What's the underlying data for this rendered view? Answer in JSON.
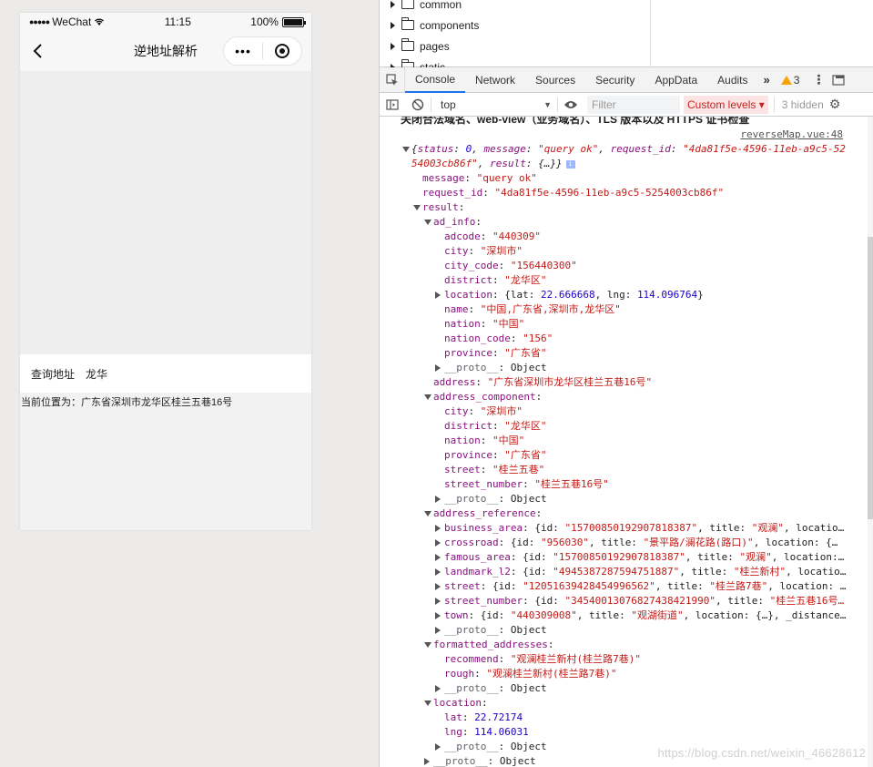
{
  "phone": {
    "status": {
      "carrier": "WeChat",
      "time": "11:15",
      "battery": "100%",
      "battery_level": 1.0
    },
    "nav": {
      "title": "逆地址解析",
      "more_label": "•••"
    },
    "query": {
      "label": "查询地址",
      "value": "龙华"
    },
    "current_location": "当前位置为：广东省深圳市龙华区桂兰五巷16号"
  },
  "devtools": {
    "file_tree": [
      "common",
      "components",
      "pages",
      "static"
    ],
    "tabs": [
      "Console",
      "Network",
      "Sources",
      "Security",
      "AppData",
      "Audits"
    ],
    "active_tab": "Console",
    "more_tabs": "»",
    "warning_count": "3",
    "toolbar": {
      "context": "top",
      "filter_placeholder": "Filter",
      "levels": "Custom levels ▾",
      "hidden": "3 hidden"
    },
    "header_text": "关闭合法域名、web-view（业务域名）、TLS 版本以及 HTTPS 证书检查",
    "source_link": "reverseMap.vue:48",
    "watermark": "https://blog.csdn.net/weixin_46628612"
  },
  "console_lines": [
    {
      "indent": 0,
      "caret": "down",
      "parts": [
        [
          "plain",
          "{"
        ],
        [
          "key",
          "status"
        ],
        [
          "plain",
          ": "
        ],
        [
          "num",
          "0"
        ],
        [
          "plain",
          ", "
        ],
        [
          "key",
          "message"
        ],
        [
          "plain",
          ": "
        ],
        [
          "str",
          "\"query ok\""
        ],
        [
          "plain",
          ", "
        ],
        [
          "key",
          "request_id"
        ],
        [
          "plain",
          ": "
        ],
        [
          "str",
          "\"4da81f5e-4596-11eb-a9c5-52"
        ]
      ]
    },
    {
      "indent": 0,
      "caret": "",
      "parts": [
        [
          "str",
          "54003cb86f\""
        ],
        [
          "plain",
          ", "
        ],
        [
          "key",
          "result"
        ],
        [
          "plain",
          ": {…}}"
        ]
      ],
      "badge": true
    },
    {
      "indent": 1,
      "caret": "",
      "parts": [
        [
          "key",
          "message"
        ],
        [
          "plain",
          ": "
        ],
        [
          "str",
          "\"query ok\""
        ]
      ]
    },
    {
      "indent": 1,
      "caret": "",
      "parts": [
        [
          "key",
          "request_id"
        ],
        [
          "plain",
          ": "
        ],
        [
          "str",
          "\"4da81f5e-4596-11eb-a9c5-5254003cb86f\""
        ]
      ]
    },
    {
      "indent": 1,
      "caret": "down",
      "parts": [
        [
          "key",
          "result"
        ],
        [
          "plain",
          ":"
        ]
      ]
    },
    {
      "indent": 2,
      "caret": "down",
      "parts": [
        [
          "key",
          "ad_info"
        ],
        [
          "plain",
          ":"
        ]
      ]
    },
    {
      "indent": 3,
      "caret": "",
      "parts": [
        [
          "key",
          "adcode"
        ],
        [
          "plain",
          ": "
        ],
        [
          "str",
          "\"440309\""
        ]
      ]
    },
    {
      "indent": 3,
      "caret": "",
      "parts": [
        [
          "key",
          "city"
        ],
        [
          "plain",
          ": "
        ],
        [
          "str",
          "\"深圳市\""
        ]
      ]
    },
    {
      "indent": 3,
      "caret": "",
      "parts": [
        [
          "key",
          "city_code"
        ],
        [
          "plain",
          ": "
        ],
        [
          "str",
          "\"156440300\""
        ]
      ]
    },
    {
      "indent": 3,
      "caret": "",
      "parts": [
        [
          "key",
          "district"
        ],
        [
          "plain",
          ": "
        ],
        [
          "str",
          "\"龙华区\""
        ]
      ]
    },
    {
      "indent": 3,
      "caret": "right",
      "parts": [
        [
          "key",
          "location"
        ],
        [
          "plain",
          ": {lat: "
        ],
        [
          "num",
          "22.666668"
        ],
        [
          "plain",
          ", lng: "
        ],
        [
          "num",
          "114.096764"
        ],
        [
          "plain",
          "}"
        ]
      ]
    },
    {
      "indent": 3,
      "caret": "",
      "parts": [
        [
          "key",
          "name"
        ],
        [
          "plain",
          ": "
        ],
        [
          "str",
          "\"中国,广东省,深圳市,龙华区\""
        ]
      ]
    },
    {
      "indent": 3,
      "caret": "",
      "parts": [
        [
          "key",
          "nation"
        ],
        [
          "plain",
          ": "
        ],
        [
          "str",
          "\"中国\""
        ]
      ]
    },
    {
      "indent": 3,
      "caret": "",
      "parts": [
        [
          "key",
          "nation_code"
        ],
        [
          "plain",
          ": "
        ],
        [
          "str",
          "\"156\""
        ]
      ]
    },
    {
      "indent": 3,
      "caret": "",
      "parts": [
        [
          "key",
          "province"
        ],
        [
          "plain",
          ": "
        ],
        [
          "str",
          "\"广东省\""
        ]
      ]
    },
    {
      "indent": 3,
      "caret": "right",
      "parts": [
        [
          "proto",
          "__proto__"
        ],
        [
          "plain",
          ": Object"
        ]
      ]
    },
    {
      "indent": 2,
      "caret": "",
      "parts": [
        [
          "key",
          "address"
        ],
        [
          "plain",
          ": "
        ],
        [
          "str",
          "\"广东省深圳市龙华区桂兰五巷16号\""
        ]
      ]
    },
    {
      "indent": 2,
      "caret": "down",
      "parts": [
        [
          "key",
          "address_component"
        ],
        [
          "plain",
          ":"
        ]
      ]
    },
    {
      "indent": 3,
      "caret": "",
      "parts": [
        [
          "key",
          "city"
        ],
        [
          "plain",
          ": "
        ],
        [
          "str",
          "\"深圳市\""
        ]
      ]
    },
    {
      "indent": 3,
      "caret": "",
      "parts": [
        [
          "key",
          "district"
        ],
        [
          "plain",
          ": "
        ],
        [
          "str",
          "\"龙华区\""
        ]
      ]
    },
    {
      "indent": 3,
      "caret": "",
      "parts": [
        [
          "key",
          "nation"
        ],
        [
          "plain",
          ": "
        ],
        [
          "str",
          "\"中国\""
        ]
      ]
    },
    {
      "indent": 3,
      "caret": "",
      "parts": [
        [
          "key",
          "province"
        ],
        [
          "plain",
          ": "
        ],
        [
          "str",
          "\"广东省\""
        ]
      ]
    },
    {
      "indent": 3,
      "caret": "",
      "parts": [
        [
          "key",
          "street"
        ],
        [
          "plain",
          ": "
        ],
        [
          "str",
          "\"桂兰五巷\""
        ]
      ]
    },
    {
      "indent": 3,
      "caret": "",
      "parts": [
        [
          "key",
          "street_number"
        ],
        [
          "plain",
          ": "
        ],
        [
          "str",
          "\"桂兰五巷16号\""
        ]
      ]
    },
    {
      "indent": 3,
      "caret": "right",
      "parts": [
        [
          "proto",
          "__proto__"
        ],
        [
          "plain",
          ": Object"
        ]
      ]
    },
    {
      "indent": 2,
      "caret": "down",
      "parts": [
        [
          "key",
          "address_reference"
        ],
        [
          "plain",
          ":"
        ]
      ]
    },
    {
      "indent": 3,
      "caret": "right",
      "parts": [
        [
          "key",
          "business_area"
        ],
        [
          "plain",
          ": {id: "
        ],
        [
          "str",
          "\"15700850192907818387\""
        ],
        [
          "plain",
          ", title: "
        ],
        [
          "str",
          "\"观澜\""
        ],
        [
          "plain",
          ", locatio…"
        ]
      ]
    },
    {
      "indent": 3,
      "caret": "right",
      "parts": [
        [
          "key",
          "crossroad"
        ],
        [
          "plain",
          ": {id: "
        ],
        [
          "str",
          "\"956030\""
        ],
        [
          "plain",
          ", title: "
        ],
        [
          "str",
          "\"景平路/澜花路(路口)\""
        ],
        [
          "plain",
          ", location: {…"
        ]
      ]
    },
    {
      "indent": 3,
      "caret": "right",
      "parts": [
        [
          "key",
          "famous_area"
        ],
        [
          "plain",
          ": {id: "
        ],
        [
          "str",
          "\"15700850192907818387\""
        ],
        [
          "plain",
          ", title: "
        ],
        [
          "str",
          "\"观澜\""
        ],
        [
          "plain",
          ", location:…"
        ]
      ]
    },
    {
      "indent": 3,
      "caret": "right",
      "parts": [
        [
          "key",
          "landmark_l2"
        ],
        [
          "plain",
          ": {id: "
        ],
        [
          "str",
          "\"4945387287594751887\""
        ],
        [
          "plain",
          ", title: "
        ],
        [
          "str",
          "\"桂兰新村\""
        ],
        [
          "plain",
          ", locatio…"
        ]
      ]
    },
    {
      "indent": 3,
      "caret": "right",
      "parts": [
        [
          "key",
          "street"
        ],
        [
          "plain",
          ": {id: "
        ],
        [
          "str",
          "\"12051639428454996562\""
        ],
        [
          "plain",
          ", title: "
        ],
        [
          "str",
          "\"桂兰路7巷\""
        ],
        [
          "plain",
          ", location: …"
        ]
      ]
    },
    {
      "indent": 3,
      "caret": "right",
      "parts": [
        [
          "key",
          "street_number"
        ],
        [
          "plain",
          ": {id: "
        ],
        [
          "str",
          "\"3454001307682743842199​0\""
        ],
        [
          "plain",
          ", title: "
        ],
        [
          "str",
          "\"桂兰五巷16号…"
        ]
      ]
    },
    {
      "indent": 3,
      "caret": "right",
      "parts": [
        [
          "key",
          "town"
        ],
        [
          "plain",
          ": {id: "
        ],
        [
          "str",
          "\"440309008\""
        ],
        [
          "plain",
          ", title: "
        ],
        [
          "str",
          "\"观湖街道\""
        ],
        [
          "plain",
          ", location: {…}, _distance…"
        ]
      ]
    },
    {
      "indent": 3,
      "caret": "right",
      "parts": [
        [
          "proto",
          "__proto__"
        ],
        [
          "plain",
          ": Object"
        ]
      ]
    },
    {
      "indent": 2,
      "caret": "down",
      "parts": [
        [
          "key",
          "formatted_addresses"
        ],
        [
          "plain",
          ":"
        ]
      ]
    },
    {
      "indent": 3,
      "caret": "",
      "parts": [
        [
          "key",
          "recommend"
        ],
        [
          "plain",
          ": "
        ],
        [
          "str",
          "\"观澜桂兰新村(桂兰路7巷)\""
        ]
      ]
    },
    {
      "indent": 3,
      "caret": "",
      "parts": [
        [
          "key",
          "rough"
        ],
        [
          "plain",
          ": "
        ],
        [
          "str",
          "\"观澜桂兰新村(桂兰路7巷)\""
        ]
      ]
    },
    {
      "indent": 3,
      "caret": "right",
      "parts": [
        [
          "proto",
          "__proto__"
        ],
        [
          "plain",
          ": Object"
        ]
      ]
    },
    {
      "indent": 2,
      "caret": "down",
      "parts": [
        [
          "key",
          "location"
        ],
        [
          "plain",
          ":"
        ]
      ]
    },
    {
      "indent": 3,
      "caret": "",
      "parts": [
        [
          "key",
          "lat"
        ],
        [
          "plain",
          ": "
        ],
        [
          "num",
          "22.72174"
        ]
      ]
    },
    {
      "indent": 3,
      "caret": "",
      "parts": [
        [
          "key",
          "lng"
        ],
        [
          "plain",
          ": "
        ],
        [
          "num",
          "114.06031"
        ]
      ]
    },
    {
      "indent": 3,
      "caret": "right",
      "parts": [
        [
          "proto",
          "__proto__"
        ],
        [
          "plain",
          ": Object"
        ]
      ]
    },
    {
      "indent": 2,
      "caret": "right",
      "parts": [
        [
          "proto",
          "__proto__"
        ],
        [
          "plain",
          ": Object"
        ]
      ]
    }
  ]
}
